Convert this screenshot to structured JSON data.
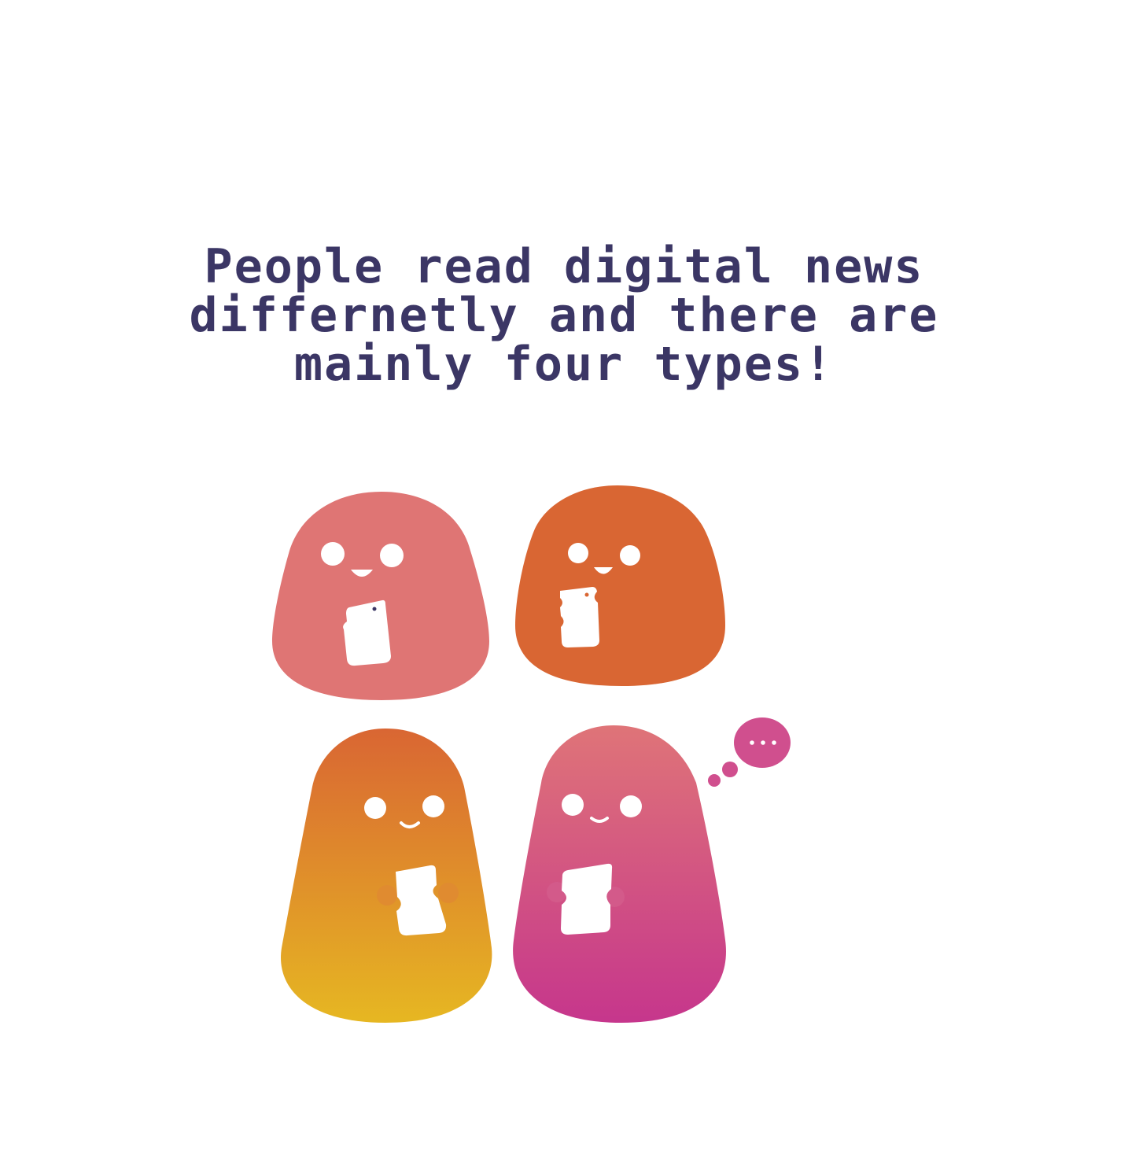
{
  "headline": {
    "lines": [
      "People read digital news",
      "differnetly and there are",
      "mainly four types!"
    ]
  },
  "colors": {
    "title": "#3b3665",
    "pink": "#df7574",
    "orange": "#d96633",
    "gradient_orange_top": "#d96633",
    "gradient_orange_bottom": "#e6b722",
    "gradient_pink_top": "#df7478",
    "gradient_pink_bottom": "#c6368c",
    "thought_bubble": "#d04f8e",
    "face": "#ffffff"
  },
  "characters": [
    {
      "name": "pink-blob",
      "icon": "blob-reading-phone"
    },
    {
      "name": "orange-blob",
      "icon": "blob-reading-phone"
    },
    {
      "name": "orange-yellow-blob",
      "icon": "blob-reading-phone"
    },
    {
      "name": "pink-magenta-blob",
      "icon": "blob-thinking-with-phone"
    }
  ],
  "thought_bubble": {
    "icon": "ellipsis-thought-icon"
  }
}
